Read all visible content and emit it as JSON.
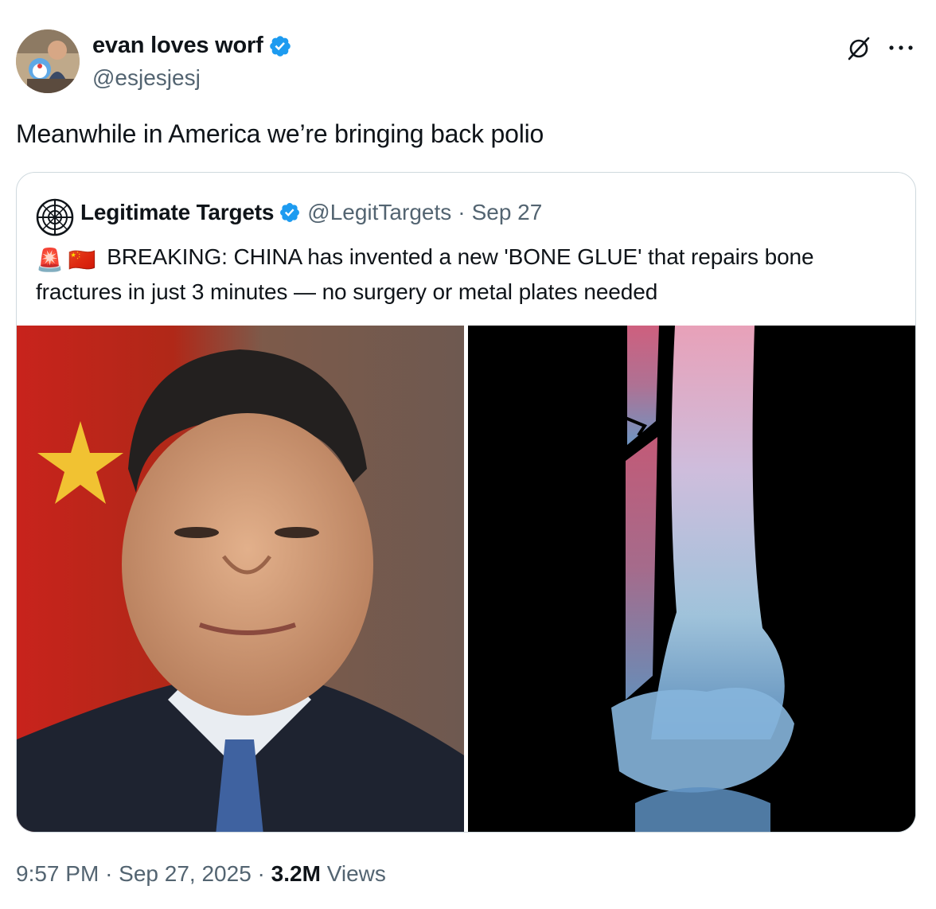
{
  "author": {
    "name": "evan loves worf",
    "handle": "@esjesjesj",
    "verified": true,
    "avatar_icon": "profile-photo"
  },
  "header_icons": [
    "grok-icon",
    "more-icon"
  ],
  "tweet": {
    "text": "Meanwhile in America we’re bringing back polio"
  },
  "quote": {
    "name": "Legitimate Targets",
    "handle": "@LegitTargets",
    "separator": "·",
    "date": "Sep 27",
    "emoji": [
      "🚨",
      "🇨🇳"
    ],
    "text": "BREAKING: CHINA has invented a new 'BONE GLUE' that repairs bone fractures in just 3 minutes — no surgery or metal plates needed",
    "images": [
      "portrait-photo",
      "leg-xray-photo"
    ]
  },
  "meta": {
    "time": "9:57 PM",
    "sep1": "·",
    "date": "Sep 27, 2025",
    "sep2": "·",
    "views_count": "3.2M",
    "views_label": "Views"
  },
  "colors": {
    "text": "#0f1419",
    "secondary": "#536471",
    "verified": "#1d9bf0",
    "border": "#cfd9de"
  }
}
